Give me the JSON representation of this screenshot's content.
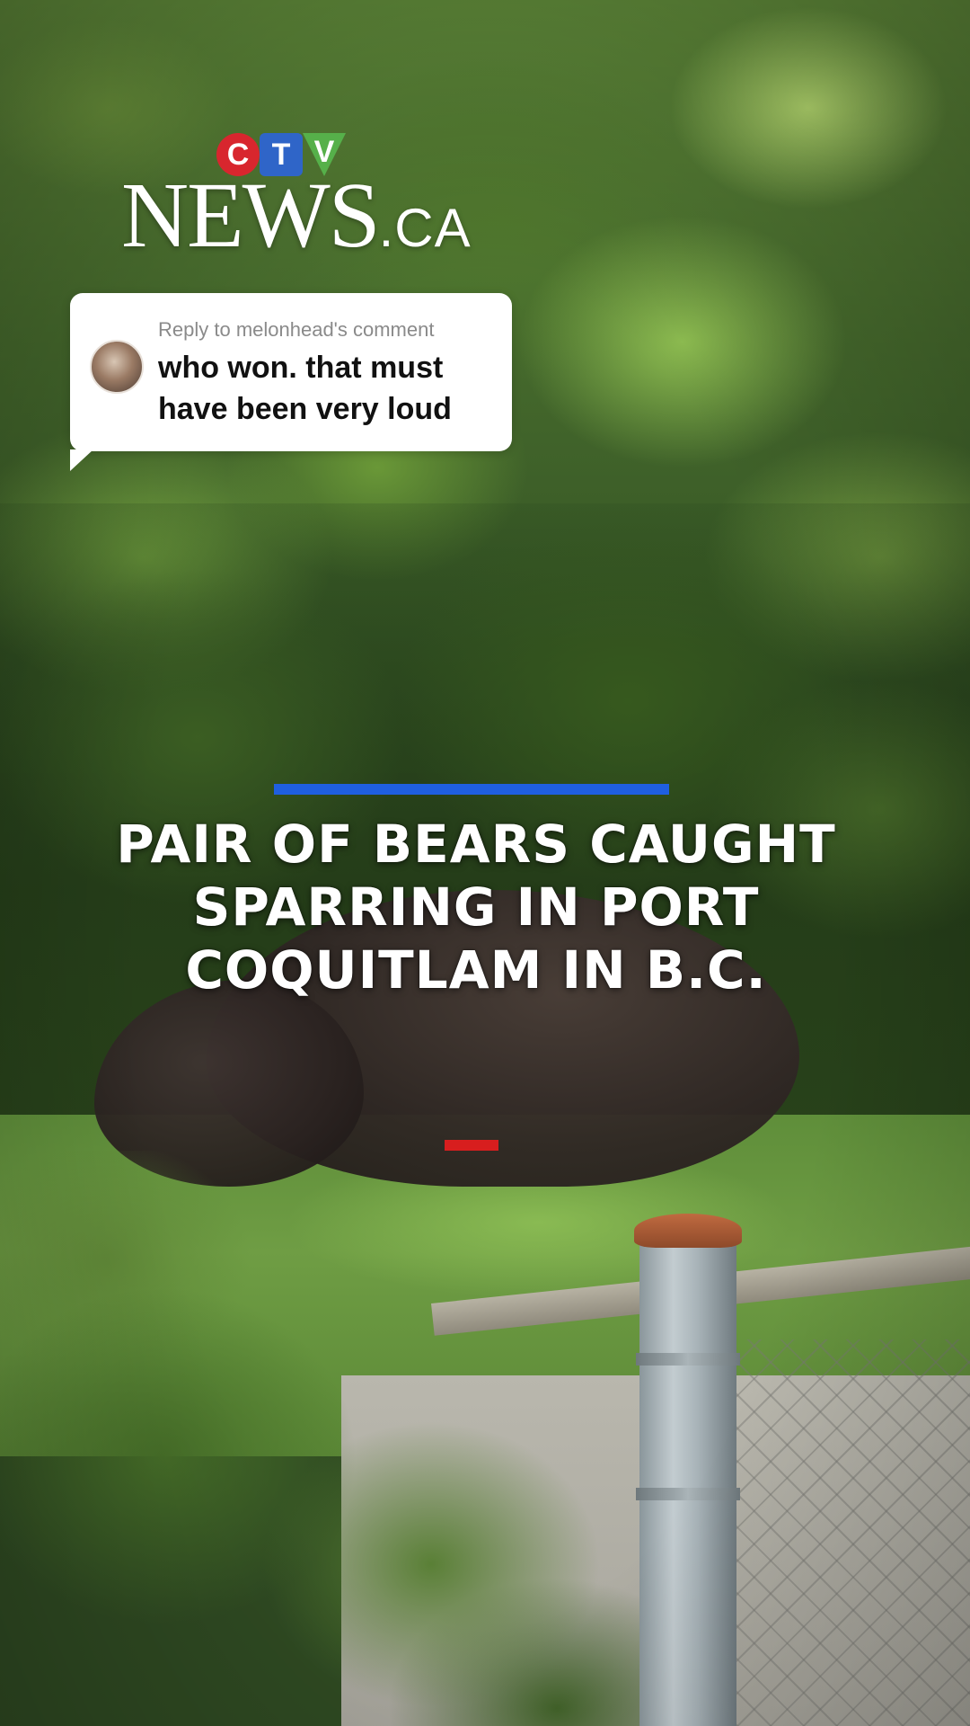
{
  "logo": {
    "ctv_letters": [
      "C",
      "T",
      "V"
    ],
    "news_word": "NEWS",
    "domain": ".CA",
    "colors": {
      "c": "#d8262e",
      "t": "#2f65c8",
      "v": "#56b04a"
    }
  },
  "reply": {
    "label": "Reply to melonhead's comment",
    "comment": "who won. that must have been very loud",
    "avatar_icon": "user-avatar"
  },
  "headline": {
    "text": "PAIR OF BEARS CAUGHT SPARRING IN PORT COQUITLAM IN B.C.",
    "accent_top_color": "#1f5fe0",
    "accent_bottom_color": "#d81e1e"
  }
}
